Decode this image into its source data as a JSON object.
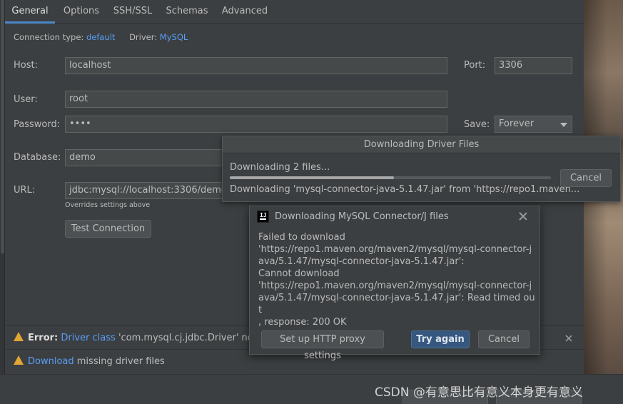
{
  "tabs": [
    "General",
    "Options",
    "SSH/SSL",
    "Schemas",
    "Advanced"
  ],
  "info": {
    "connection_type_label": "Connection type:",
    "connection_type_value": "default",
    "driver_label": "Driver:",
    "driver_value": "MySQL"
  },
  "form": {
    "host_label": "Host:",
    "host_value": "localhost",
    "port_label": "Port:",
    "port_value": "3306",
    "user_label": "User:",
    "user_value": "root",
    "password_label": "Password:",
    "password_value": "••••",
    "save_label": "Save:",
    "save_value": "Forever",
    "database_label": "Database:",
    "database_value": "demo",
    "url_label": "URL:",
    "url_value": "jdbc:mysql://localhost:3306/demo",
    "url_hint": "Overrides settings above",
    "test_connection": "Test Connection"
  },
  "status": {
    "error_prefix": "Error:",
    "error_link": "Driver class",
    "error_text": "'com.mysql.cj.jdbc.Driver' not f",
    "download_link": "Download",
    "download_text": "missing driver files"
  },
  "download_popup": {
    "title": "Downloading Driver Files",
    "status": "Downloading 2 files...",
    "progress": 0.51,
    "detail": "Downloading 'mysql-connector-java-5.1.47.jar' from 'https://repo1.maven...",
    "cancel": "Cancel"
  },
  "error_dialog": {
    "icon_text": "IJ",
    "title": "Downloading MySQL Connector/J files",
    "message": "Failed to download\n'https://repo1.maven.org/maven2/mysql/mysql-connector-java/5.1.47/mysql-connector-java-5.1.47.jar':\nCannot download\n'https://repo1.maven.org/maven2/mysql/mysql-connector-java/5.1.47/mysql-connector-java-5.1.47.jar': Read timed out\n, response: 200 OK",
    "proxy_button": "Set up HTTP proxy settings",
    "try_again_button": "Try again",
    "cancel_button": "Cancel"
  },
  "watermark": "CSDN @有意思比有意义本身更有意义"
}
